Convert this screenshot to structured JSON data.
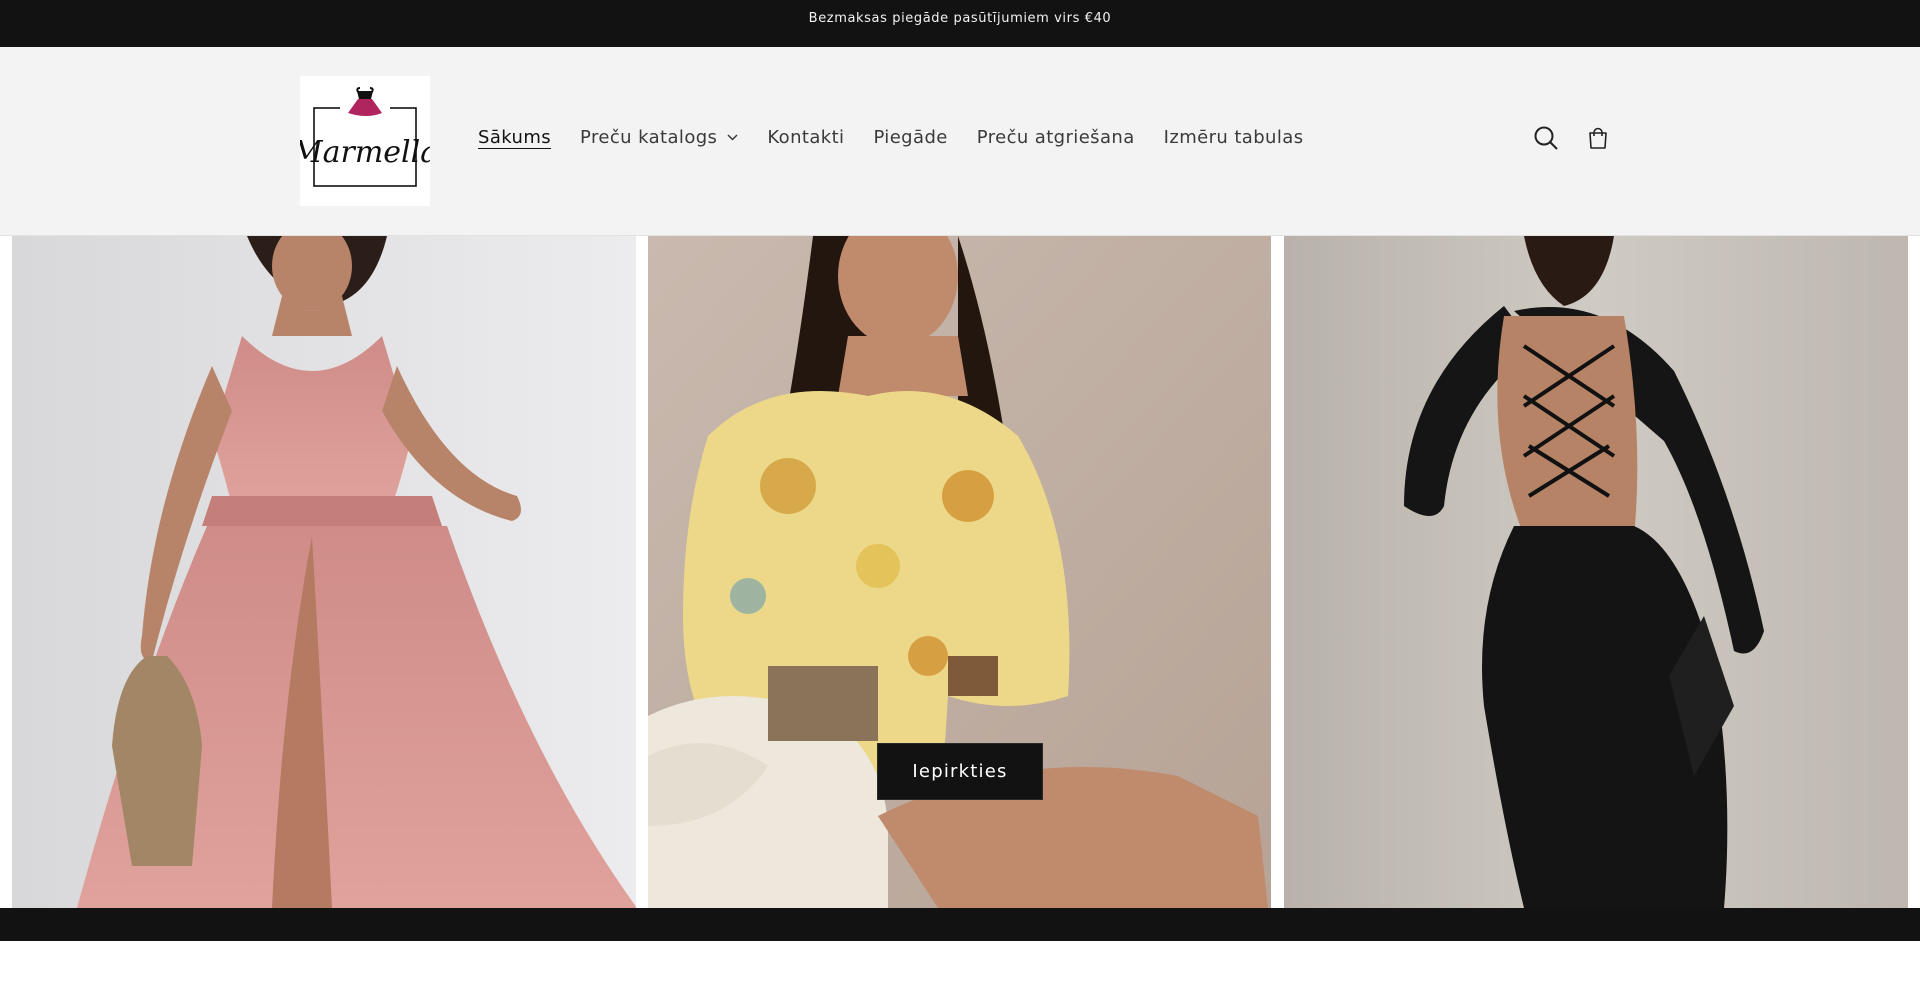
{
  "announcement": {
    "text": "Bezmaksas piegāde pasūtījumiem virs €40"
  },
  "brand": {
    "name": "Marmella",
    "logo_icon": "dress-logo-icon"
  },
  "nav": {
    "items": [
      {
        "label": "Sākums",
        "active": true,
        "has_dropdown": false
      },
      {
        "label": "Preču katalogs",
        "active": false,
        "has_dropdown": true
      },
      {
        "label": "Kontakti",
        "active": false,
        "has_dropdown": false
      },
      {
        "label": "Piegāde",
        "active": false,
        "has_dropdown": false
      },
      {
        "label": "Preču atgriešana",
        "active": false,
        "has_dropdown": false
      },
      {
        "label": "Izmēru tabulas",
        "active": false,
        "has_dropdown": false
      }
    ]
  },
  "header_icons": {
    "search": "search-icon",
    "cart": "shopping-bag-icon"
  },
  "hero": {
    "cta_label": "Iepirkties",
    "images": [
      {
        "subject": "pink halter maxi dress with side slit, beige handbag"
      },
      {
        "subject": "yellow floral long-sleeve mini dress, seated on white boucle chair"
      },
      {
        "subject": "black long-sleeve lace-up open back dress"
      }
    ]
  },
  "colors": {
    "announcement_bg": "#121212",
    "header_bg": "#f3f3f3",
    "button_bg": "#121212",
    "logo_accent": "#b0255e"
  }
}
